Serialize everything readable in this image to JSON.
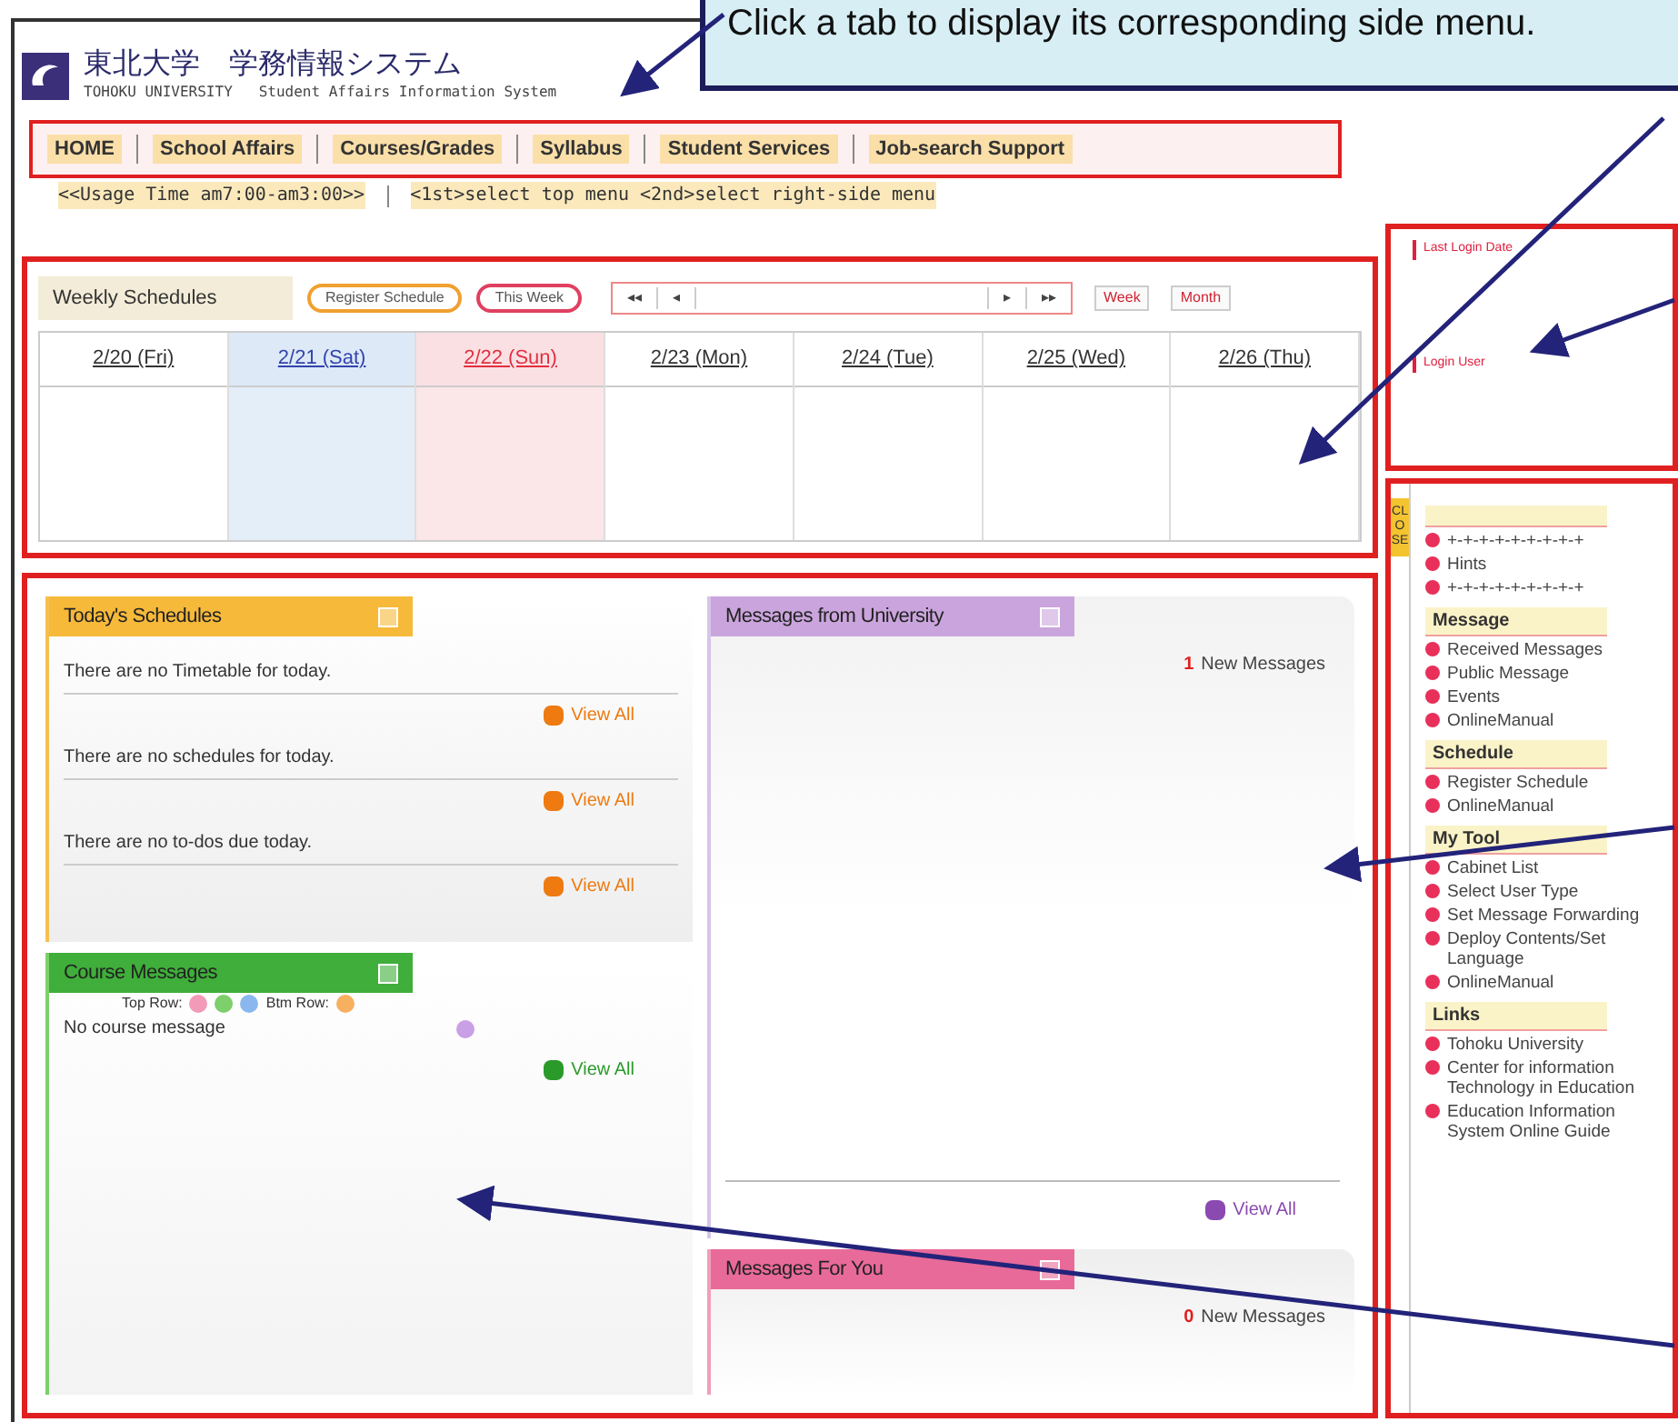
{
  "callout": {
    "text": "Click a tab to display its corresponding side menu."
  },
  "header": {
    "title_ja": "東北大学　学務情報システム",
    "title_en": "TOHOKU UNIVERSITY   Student Affairs Information System"
  },
  "nav_tabs": [
    "HOME",
    "School Affairs",
    "Courses/Grades",
    "Syllabus",
    "Student Services",
    "Job-search Support"
  ],
  "info_bar": [
    "<<Usage Time am7:00-am3:00>>",
    "<1st>select top menu <2nd>select right-side menu"
  ],
  "weekly": {
    "title": "Weekly Schedules",
    "register": "Register Schedule",
    "this_week": "This Week",
    "nav_back": [
      "◂◂",
      "◂"
    ],
    "nav_forward": [
      "▸",
      "▸▸"
    ],
    "views": [
      "Week",
      "Month"
    ],
    "days": [
      {
        "label": "2/20 (Fri)",
        "kind": "weekday"
      },
      {
        "label": "2/21 (Sat)",
        "kind": "saturday"
      },
      {
        "label": "2/22 (Sun)",
        "kind": "sunday"
      },
      {
        "label": "2/23 (Mon)",
        "kind": "weekday"
      },
      {
        "label": "2/24 (Tue)",
        "kind": "weekday"
      },
      {
        "label": "2/25 (Wed)",
        "kind": "weekday"
      },
      {
        "label": "2/26 (Thu)",
        "kind": "weekday"
      }
    ]
  },
  "login": {
    "last_login": "Last Login Date",
    "user": "Login User"
  },
  "todays": {
    "title": "Today's Schedules",
    "rows": [
      {
        "text": "There are no Timetable for today.",
        "link": "View All"
      },
      {
        "text": "There are no schedules for today.",
        "link": "View All"
      },
      {
        "text": "There are no to-dos due today.",
        "link": "View All"
      }
    ]
  },
  "course_messages": {
    "title": "Course Messages",
    "top_row": "Top Row:",
    "btm_row": "Btm Row:",
    "empty": "No course message",
    "link": "View All"
  },
  "uni_messages": {
    "title": "Messages from University",
    "count": "1",
    "count_label": "New Messages",
    "link": "View All"
  },
  "for_you": {
    "title": "Messages For You",
    "count": "0",
    "count_label": "New Messages"
  },
  "sidebar": {
    "close": "CLOSE",
    "sections": [
      {
        "items": [
          "+-+-+-+-+-+-+-+-+",
          "Hints",
          "+-+-+-+-+-+-+-+-+"
        ]
      },
      {
        "heading": "Message",
        "items": [
          "Received Messages",
          "Public Message",
          "Events",
          "OnlineManual"
        ]
      },
      {
        "heading": "Schedule",
        "items": [
          "Register Schedule",
          "OnlineManual"
        ]
      },
      {
        "heading": "My Tool",
        "items": [
          "Cabinet List",
          "Select User Type",
          "Set Message Forwarding",
          "Deploy Contents/Set Language",
          "OnlineManual"
        ]
      },
      {
        "heading": "Links",
        "items": [
          "Tohoku University",
          "Center for information Technology in Education",
          "Education Information System Online Guide"
        ]
      }
    ]
  }
}
